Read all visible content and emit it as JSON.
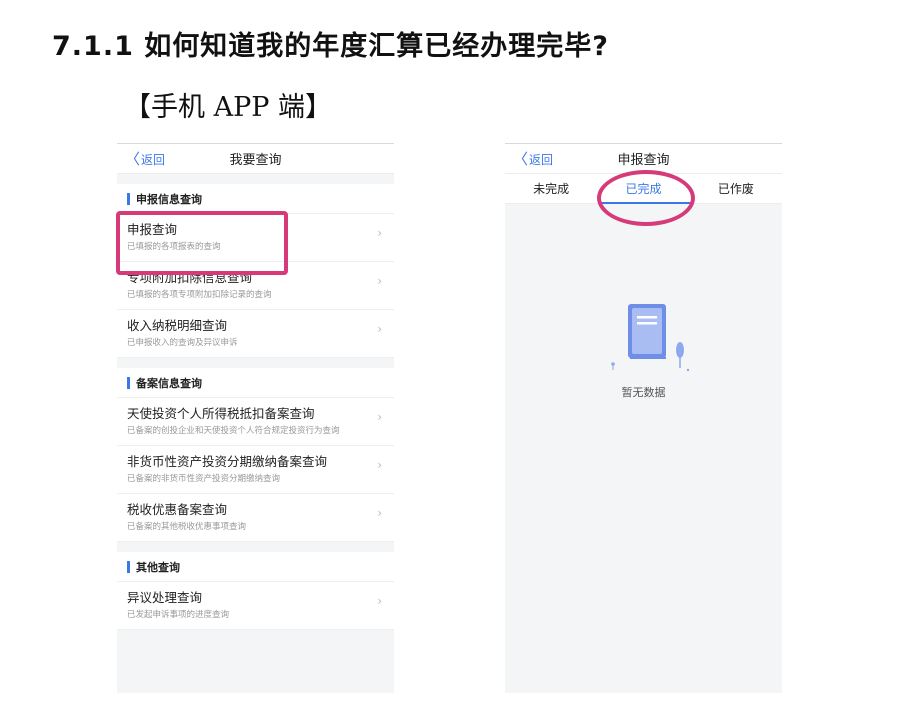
{
  "heading": "7.1.1 如何知道我的年度汇算已经办理完毕?",
  "subheading": "【手机 APP 端】",
  "left_screen": {
    "back_label": "返回",
    "title": "我要查询",
    "sections": [
      {
        "header": "申报信息查询",
        "rows": [
          {
            "title": "申报查询",
            "subtitle": "已填报的各项报表的查询"
          },
          {
            "title": "专项附加扣除信息查询",
            "subtitle": "已填报的各项专项附加扣除记录的查询"
          },
          {
            "title": "收入纳税明细查询",
            "subtitle": "已申报收入的查询及异议申诉"
          }
        ]
      },
      {
        "header": "备案信息查询",
        "rows": [
          {
            "title": "天使投资个人所得税抵扣备案查询",
            "subtitle": "已备案的创投企业和天使投资个人符合规定投资行为查询"
          },
          {
            "title": "非货币性资产投资分期缴纳备案查询",
            "subtitle": "已备案的非货币性资产投资分期缴纳查询"
          },
          {
            "title": "税收优惠备案查询",
            "subtitle": "已备案的其他税收优惠事项查询"
          }
        ]
      },
      {
        "header": "其他查询",
        "rows": [
          {
            "title": "异议处理查询",
            "subtitle": "已发起申诉事项的进度查询"
          }
        ]
      }
    ]
  },
  "right_screen": {
    "back_label": "返回",
    "title": "申报查询",
    "tabs": [
      "未完成",
      "已完成",
      "已作废"
    ],
    "active_tab": "已完成",
    "empty_text": "暂无数据"
  },
  "colors": {
    "accent": "#3b78e7",
    "highlight": "#d63a78"
  }
}
